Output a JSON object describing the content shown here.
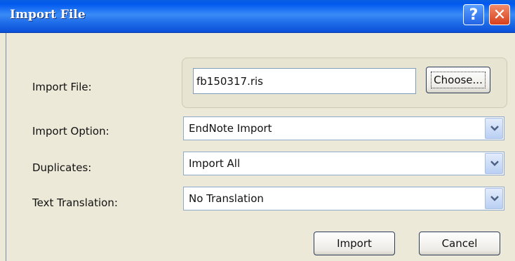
{
  "window": {
    "title": "Import File",
    "help_label": "?",
    "close_label": "✕"
  },
  "import_file": {
    "label": "Import File:",
    "value": "fb150317.ris",
    "choose_label": "Choose..."
  },
  "import_option": {
    "label": "Import Option:",
    "value": "EndNote Import"
  },
  "duplicates": {
    "label": "Duplicates:",
    "value": "Import All"
  },
  "text_translation": {
    "label": "Text Translation:",
    "value": "No Translation"
  },
  "buttons": {
    "import_label": "Import",
    "cancel_label": "Cancel"
  },
  "colors": {
    "titlebar": "#0058ee",
    "dialog_bg": "#ece9d8",
    "close_button": "#d8401c",
    "help_button": "#2264e6"
  },
  "icons": [
    "help-icon",
    "close-icon",
    "chevron-down-icon"
  ]
}
